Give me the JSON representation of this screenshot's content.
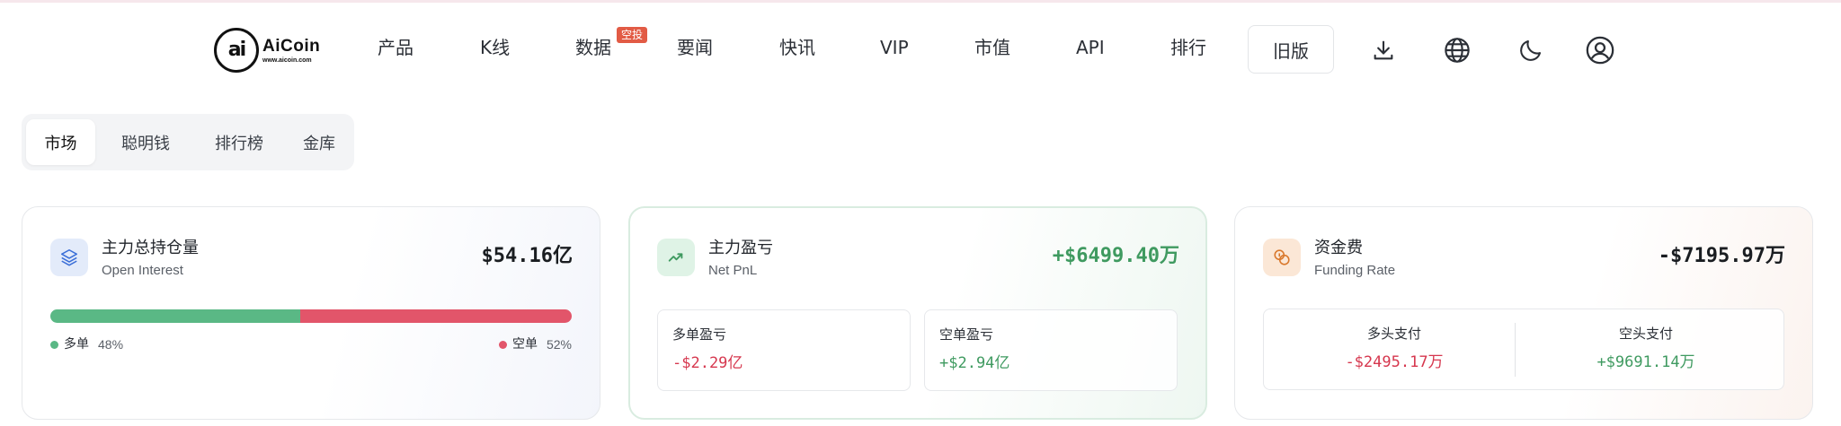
{
  "logo": {
    "brand": "AiCoin",
    "url": "www.aicoin.com",
    "mark": "ai"
  },
  "nav": {
    "items": [
      "产品",
      "K线",
      "数据",
      "要闻",
      "快讯",
      "VIP",
      "市值",
      "API",
      "排行"
    ],
    "badge": "空投",
    "old_version": "旧版",
    "icons": [
      "download-icon",
      "globe-icon",
      "moon-icon",
      "user-icon"
    ]
  },
  "tabs": {
    "items": [
      "市场",
      "聪明钱",
      "排行榜",
      "金库"
    ],
    "active": "市场"
  },
  "cards": {
    "open_interest": {
      "title": "主力总持仓量",
      "subtitle": "Open Interest",
      "value": "$54.16亿",
      "icon": "layers-icon",
      "long_label": "多单",
      "long_pct": "48%",
      "short_label": "空单",
      "short_pct": "52%",
      "long_fraction": 0.48
    },
    "net_pnl": {
      "title": "主力盈亏",
      "subtitle": "Net PnL",
      "value": "+$6499.40万",
      "icon": "trending-up-icon",
      "long_label": "多单盈亏",
      "long_value": "-$2.29亿",
      "short_label": "空单盈亏",
      "short_value": "+$2.94亿"
    },
    "funding_rate": {
      "title": "资金费",
      "subtitle": "Funding Rate",
      "value": "-$7195.97万",
      "icon": "coins-icon",
      "long_label": "多头支付",
      "long_value": "-$2495.17万",
      "short_label": "空头支付",
      "short_value": "+$9691.14万"
    }
  },
  "colors": {
    "long_green": "#5ab885",
    "short_red": "#e2556a",
    "positive": "#3f9a60",
    "negative": "#d6374e",
    "badge": "#e25b45"
  }
}
